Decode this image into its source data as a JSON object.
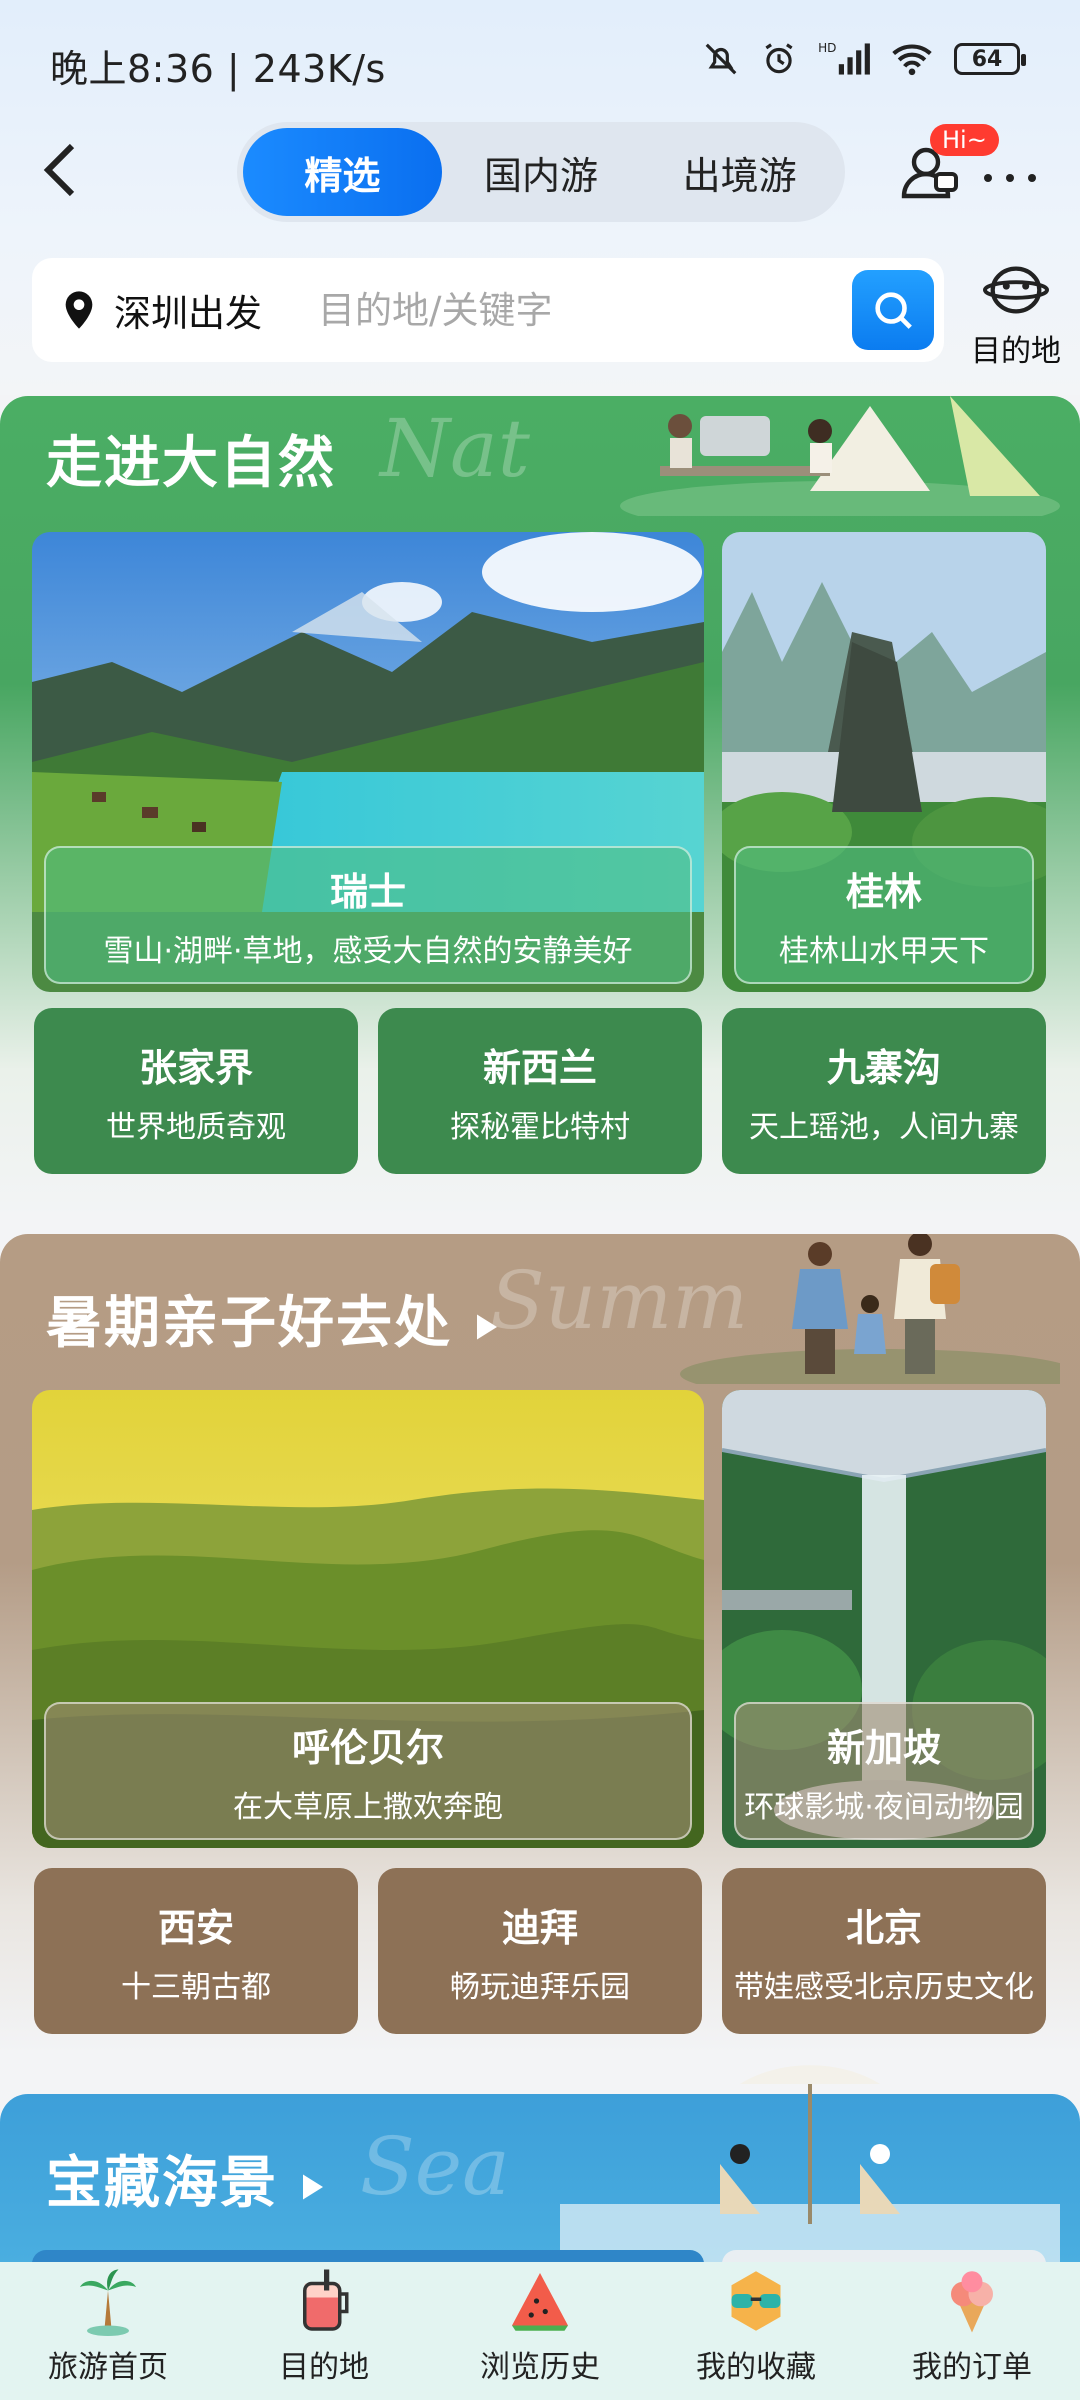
{
  "status_bar": {
    "time": "晚上8:36 | 243K/s",
    "battery": "64"
  },
  "nav": {
    "tabs": [
      {
        "label": "精选",
        "active": true
      },
      {
        "label": "国内游",
        "active": false
      },
      {
        "label": "出境游",
        "active": false
      }
    ],
    "badge": "Hi~"
  },
  "search": {
    "origin": "深圳出发",
    "placeholder": "目的地/关键字",
    "destination_label": "目的地"
  },
  "sections": [
    {
      "title": "走进大自然",
      "watermark": "Nat",
      "big_cards": [
        {
          "title": "瑞士",
          "subtitle": "雪山·湖畔·草地，感受大自然的安静美好"
        },
        {
          "title": "桂林",
          "subtitle": "桂林山水甲天下"
        }
      ],
      "small_cards": [
        {
          "title": "张家界",
          "subtitle": "世界地质奇观"
        },
        {
          "title": "新西兰",
          "subtitle": "探秘霍比特村"
        },
        {
          "title": "九寨沟",
          "subtitle": "天上瑶池，人间九寨"
        }
      ]
    },
    {
      "title": "暑期亲子好去处",
      "watermark": "Summ",
      "big_cards": [
        {
          "title": "呼伦贝尔",
          "subtitle": "在大草原上撒欢奔跑"
        },
        {
          "title": "新加坡",
          "subtitle": "环球影城·夜间动物园"
        }
      ],
      "small_cards": [
        {
          "title": "西安",
          "subtitle": "十三朝古都"
        },
        {
          "title": "迪拜",
          "subtitle": "畅玩迪拜乐园"
        },
        {
          "title": "北京",
          "subtitle": "带娃感受北京历史文化"
        }
      ]
    },
    {
      "title": "宝藏海景",
      "watermark": "Sea"
    }
  ],
  "bottom_nav": [
    {
      "label": "旅游首页",
      "icon": "palm-tree-icon"
    },
    {
      "label": "目的地",
      "icon": "drink-icon"
    },
    {
      "label": "浏览历史",
      "icon": "watermelon-icon"
    },
    {
      "label": "我的收藏",
      "icon": "sunglasses-icon"
    },
    {
      "label": "我的订单",
      "icon": "ice-cream-icon"
    }
  ],
  "colors": {
    "accent": "#0b7cf0",
    "nature": "#3d8a4e",
    "family": "#8d7156",
    "sea": "#3aa3d8"
  }
}
